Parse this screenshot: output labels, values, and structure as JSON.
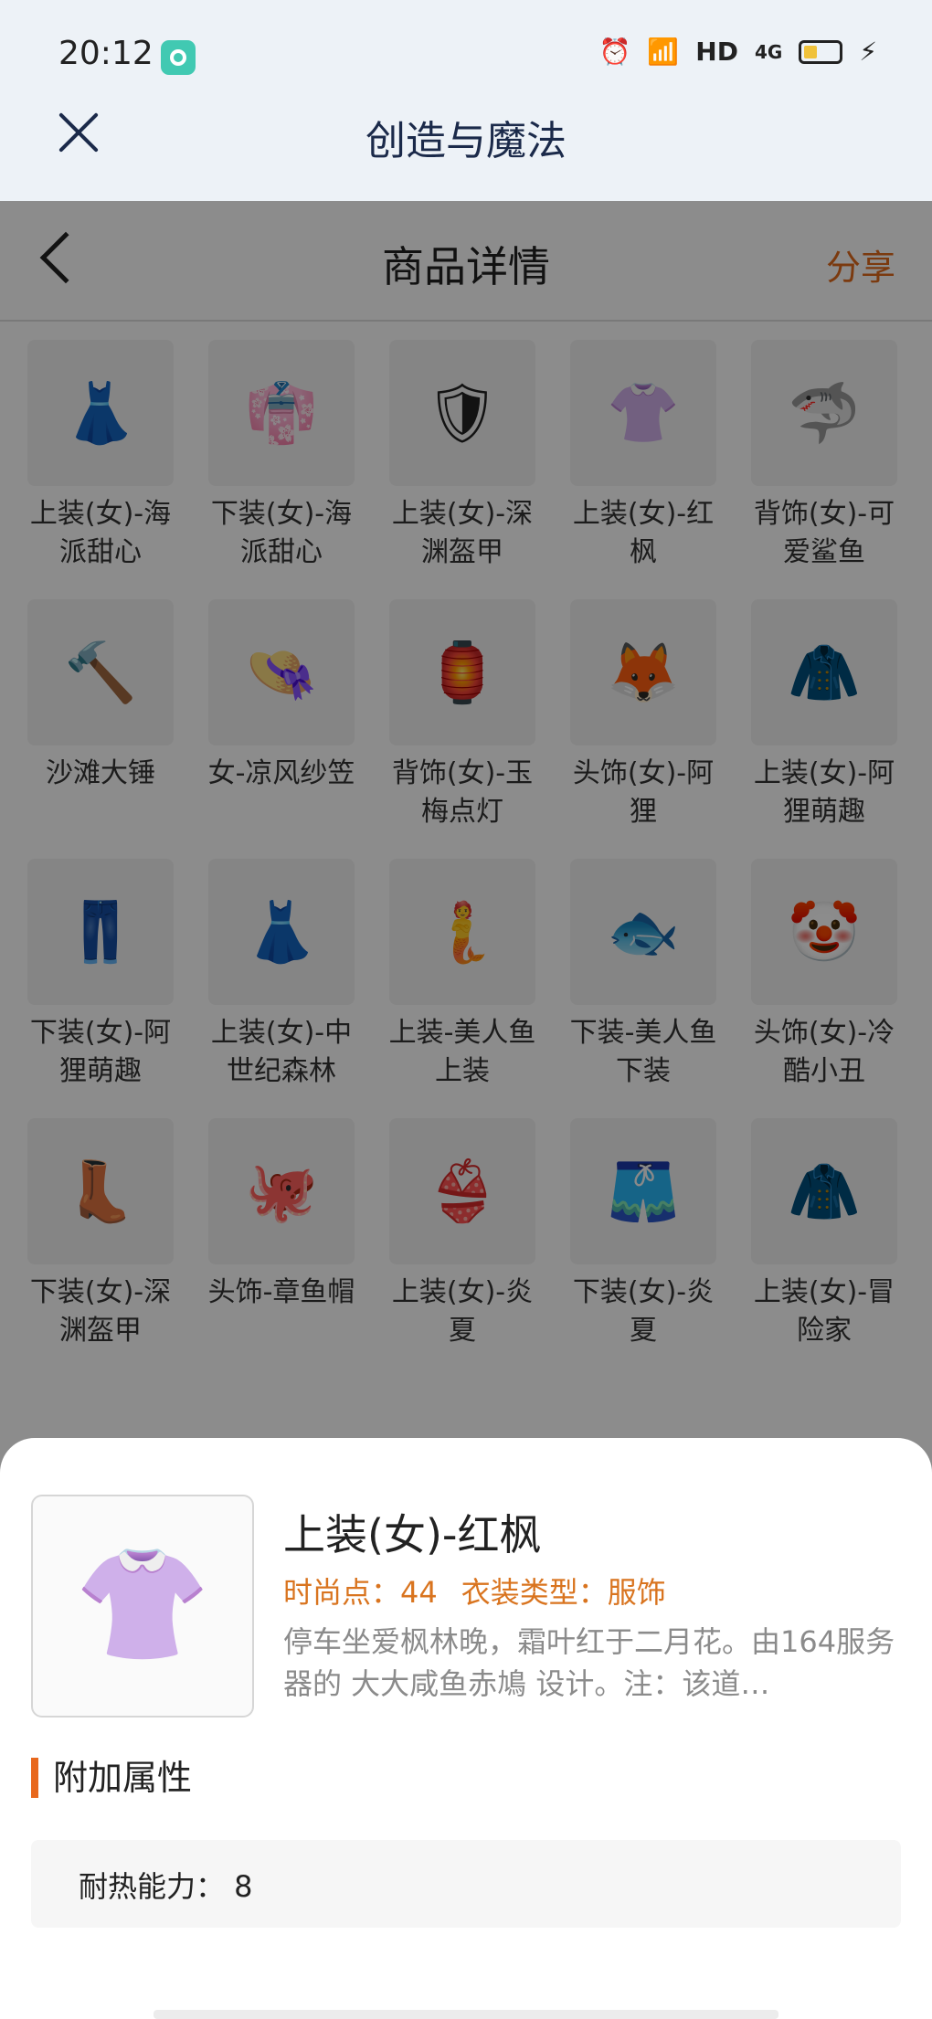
{
  "status_bar": {
    "time": "20:12",
    "network": "HD",
    "signal": "4G"
  },
  "app_bar": {
    "title": "创造与魔法"
  },
  "page": {
    "title": "商品详情",
    "share": "分享",
    "items": [
      {
        "label": "上装(女)-海派甜心",
        "icon": "👗"
      },
      {
        "label": "下装(女)-海派甜心",
        "icon": "👘"
      },
      {
        "label": "上装(女)-深渊盔甲",
        "icon": "🛡"
      },
      {
        "label": "上装(女)-红枫",
        "icon": "👚"
      },
      {
        "label": "背饰(女)-可爱鲨鱼",
        "icon": "🦈"
      },
      {
        "label": "沙滩大锤",
        "icon": "🔨"
      },
      {
        "label": "女-凉风纱笠",
        "icon": "👒"
      },
      {
        "label": "背饰(女)-玉梅点灯",
        "icon": "🏮"
      },
      {
        "label": "头饰(女)-阿狸",
        "icon": "🦊"
      },
      {
        "label": "上装(女)-阿狸萌趣",
        "icon": "🧥"
      },
      {
        "label": "下装(女)-阿狸萌趣",
        "icon": "👖"
      },
      {
        "label": "上装(女)-中世纪森林",
        "icon": "👗"
      },
      {
        "label": "上装-美人鱼上装",
        "icon": "🧜"
      },
      {
        "label": "下装-美人鱼下装",
        "icon": "🐟"
      },
      {
        "label": "头饰(女)-冷酷小丑",
        "icon": "🤡"
      },
      {
        "label": "下装(女)-深渊盔甲",
        "icon": "👢"
      },
      {
        "label": "头饰-章鱼帽",
        "icon": "🐙"
      },
      {
        "label": "上装(女)-炎夏",
        "icon": "👙"
      },
      {
        "label": "下装(女)-炎夏",
        "icon": "🩳"
      },
      {
        "label": "上装(女)-冒险家",
        "icon": "🧥"
      }
    ]
  },
  "sheet": {
    "name": "上装(女)-红枫",
    "fashion_points": "时尚点：44",
    "type": "衣装类型：服饰",
    "description": "停车坐爱枫林晚，霜叶红于二月花。由164服务器的 大大咸鱼赤鳩 设计。注：该道…",
    "section_title": "附加属性",
    "attribute": "耐热能力： 8",
    "image_icon": "👚"
  }
}
